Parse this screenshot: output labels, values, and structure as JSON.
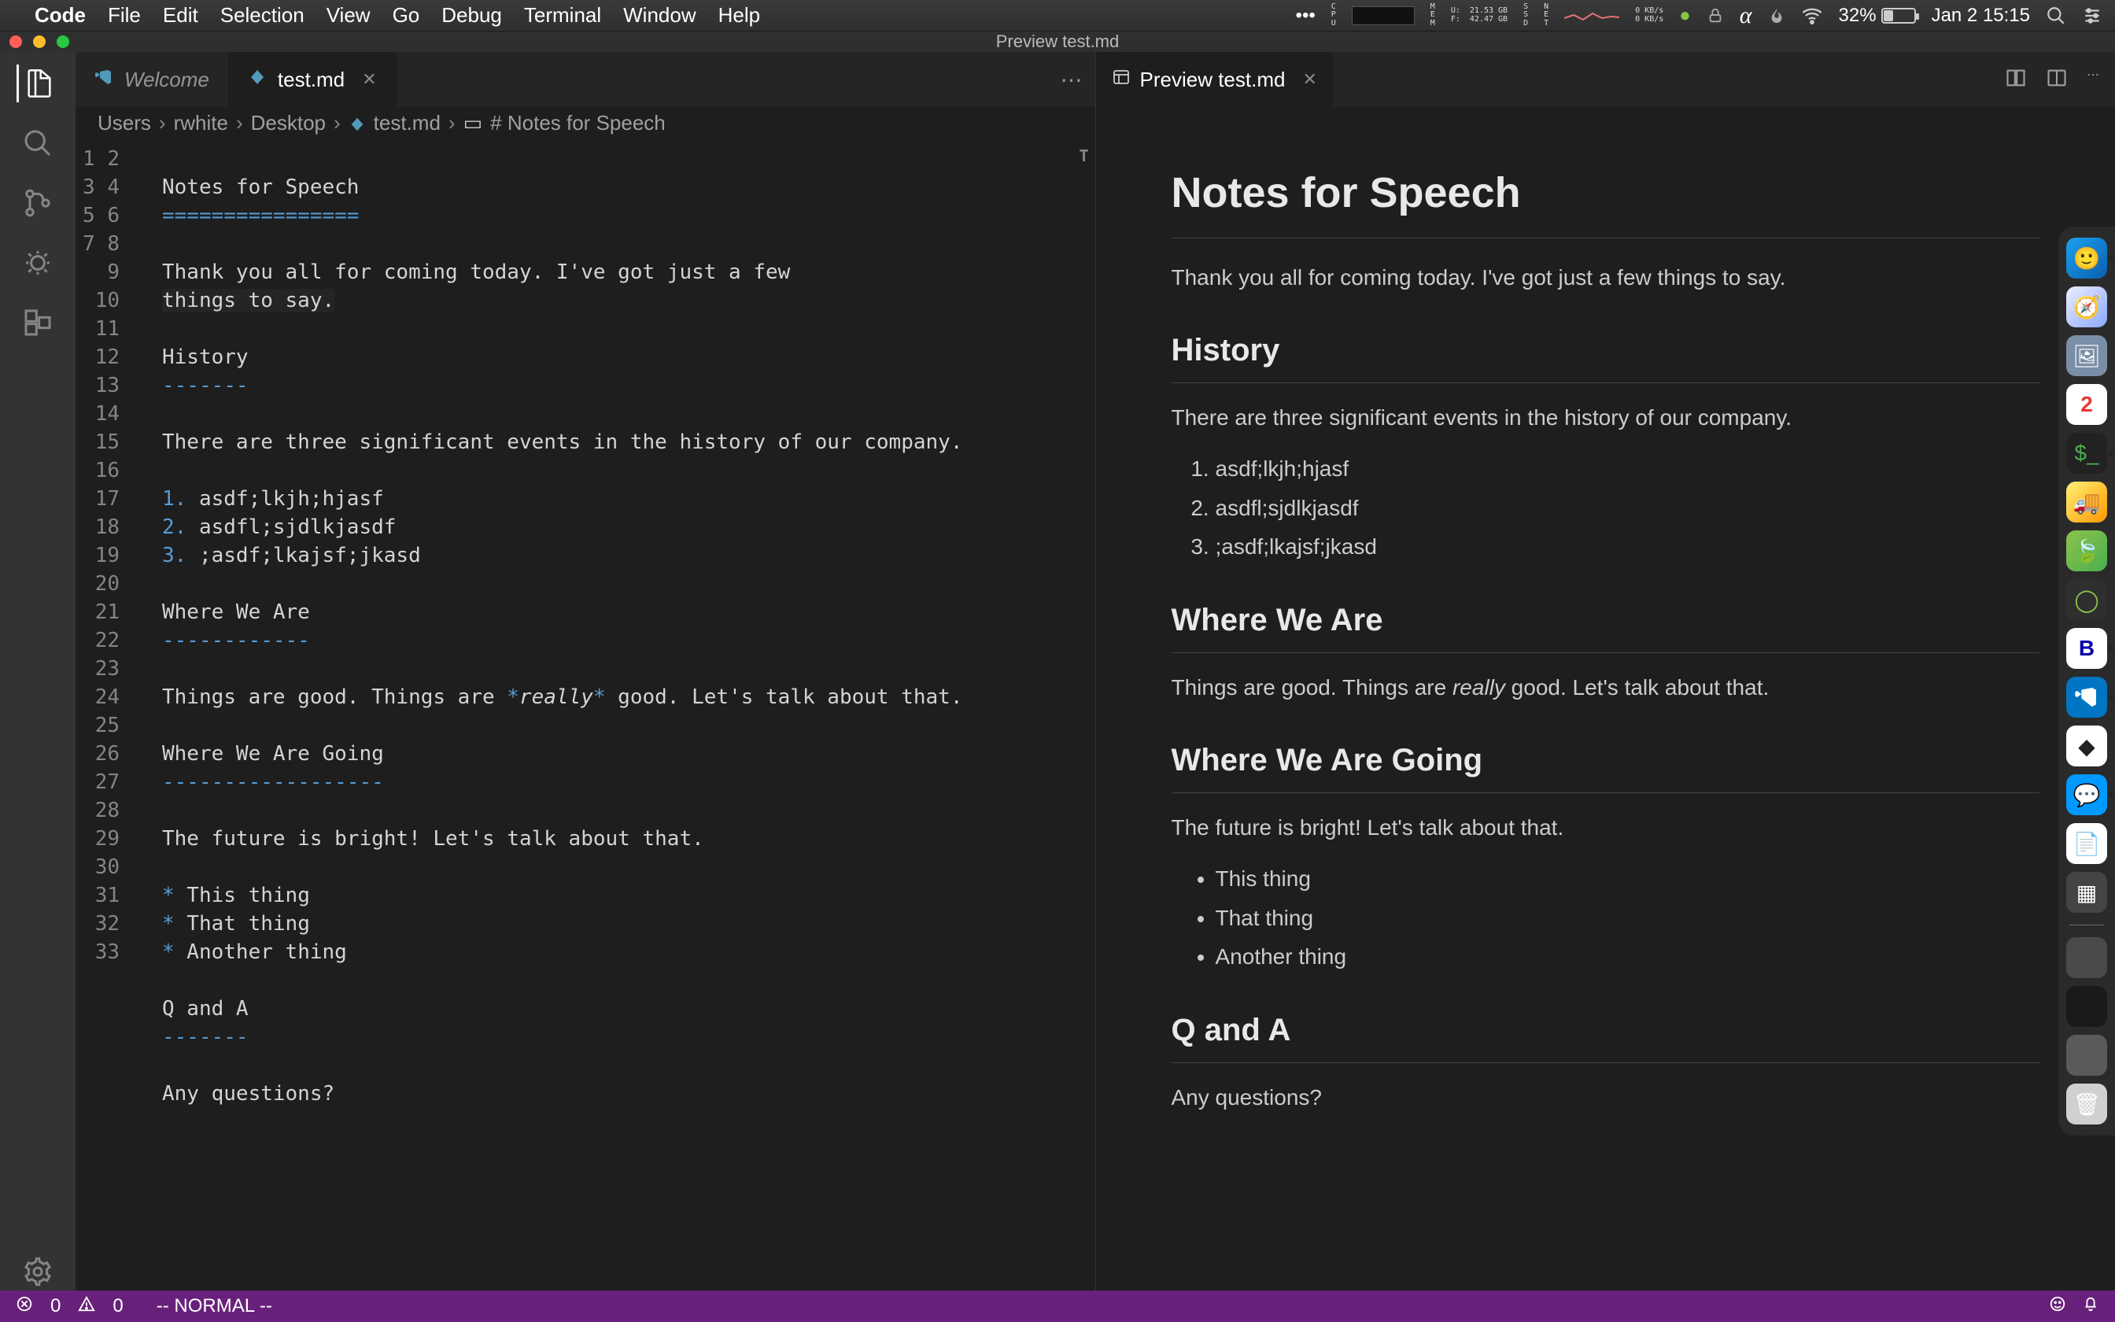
{
  "menubar": {
    "app": "Code",
    "items": [
      "File",
      "Edit",
      "Selection",
      "View",
      "Go",
      "Debug",
      "Terminal",
      "Window",
      "Help"
    ],
    "stats_cpu": "C\nP\nU",
    "stats_mem_label": "M\nE\nM",
    "stats_mem": "U:  21.53 GB\nF:  42.47 GB",
    "stats_net_label": "N\nE\nT",
    "stats_disk_label": "S\nS\nD",
    "stats_net": "0 KB/s\n0 KB/s",
    "battery_pct": "32%",
    "datetime": "Jan 2  15:15"
  },
  "window": {
    "title": "Preview test.md"
  },
  "tabs": {
    "welcome": "Welcome",
    "file": "test.md",
    "preview": "Preview test.md"
  },
  "breadcrumbs": {
    "p0": "Users",
    "p1": "rwhite",
    "p2": "Desktop",
    "p3": "test.md",
    "p4": "# Notes for Speech"
  },
  "editor": {
    "line_count": 33,
    "lines": {
      "l1": "Notes for Speech",
      "l2": "================",
      "l3": "",
      "l4": "Thank you all for coming today. I've got just a few",
      "l5": "things to say.",
      "l6": "",
      "l7": "History",
      "l8": "-------",
      "l9": "",
      "l10": "There are three significant events in the history of our company.",
      "l11": "",
      "l12_num": "1.",
      "l12_txt": " asdf;lkjh;hjasf",
      "l13_num": "2.",
      "l13_txt": " asdfl;sjdlkjasdf",
      "l14_num": "3.",
      "l14_txt": " ;asdf;lkajsf;jkasd",
      "l15": "",
      "l16": "Where We Are",
      "l17": "------------",
      "l18": "",
      "l19_a": "Things are good. Things are ",
      "l19_s1": "*",
      "l19_em": "really",
      "l19_s2": "*",
      "l19_b": " good. Let's talk about that.",
      "l20": "",
      "l21": "Where We Are Going",
      "l22": "------------------",
      "l23": "",
      "l24": "The future is bright! Let's talk about that.",
      "l25": "",
      "l26_s": "*",
      "l26_t": " This thing",
      "l27_s": "*",
      "l27_t": " That thing",
      "l28_s": "*",
      "l28_t": " Another thing",
      "l29": "",
      "l30": "Q and A",
      "l31": "-------",
      "l32": "",
      "l33": "Any questions?"
    },
    "minimap_indicator": "T"
  },
  "preview": {
    "h1": "Notes for Speech",
    "p1": "Thank you all for coming today. I've got just a few things to say.",
    "h2a": "History",
    "p2": "There are three significant events in the history of our company.",
    "ol": [
      "asdf;lkjh;hjasf",
      "asdfl;sjdlkjasdf",
      ";asdf;lkajsf;jkasd"
    ],
    "h2b": "Where We Are",
    "p3a": "Things are good. Things are ",
    "p3em": "really",
    "p3b": " good. Let's talk about that.",
    "h2c": "Where We Are Going",
    "p4": "The future is bright! Let's talk about that.",
    "ul": [
      "This thing",
      "That thing",
      "Another thing"
    ],
    "h2d": "Q and A",
    "p5": "Any questions?"
  },
  "statusbar": {
    "errors": "0",
    "warnings": "0",
    "mode": "-- NORMAL --"
  }
}
